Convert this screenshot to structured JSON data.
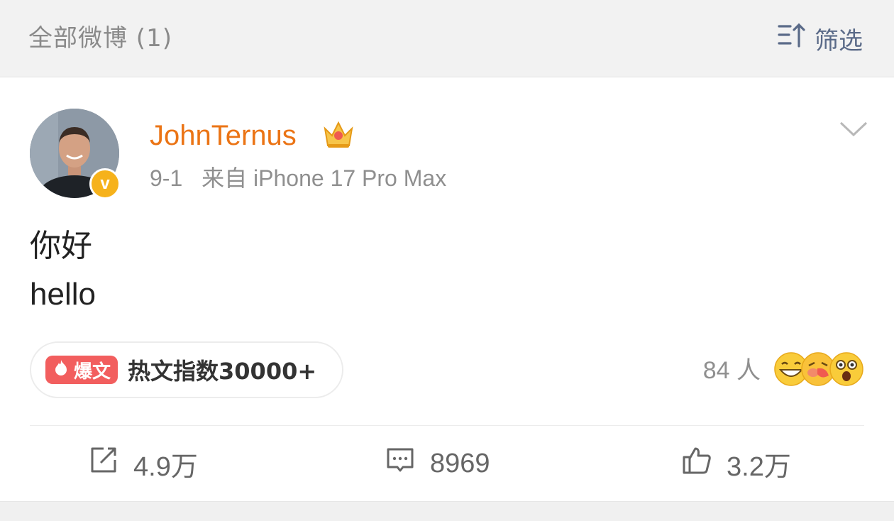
{
  "header": {
    "title": "全部微博 (1)",
    "filter_label": "筛选",
    "filter_icon": "sort-filter-icon"
  },
  "post": {
    "username": "JohnTernus",
    "date": "9-1",
    "source": "来自 iPhone 17 Pro Max",
    "content_lines": [
      "你好",
      "hello"
    ],
    "hot_badge_label": "爆文",
    "hot_text": "热文指数30000+",
    "reaction_count": "84 人",
    "reactions": [
      "laughing-emoji",
      "kiss-emoji",
      "shocked-emoji"
    ],
    "actions": {
      "repost": "4.9万",
      "comment": "8969",
      "like": "3.2万"
    }
  },
  "colors": {
    "username": "#eb7415",
    "verified_badge": "#f6b21b",
    "hot_badge": "#f25e5e",
    "filter_accent": "#5a6a88"
  }
}
